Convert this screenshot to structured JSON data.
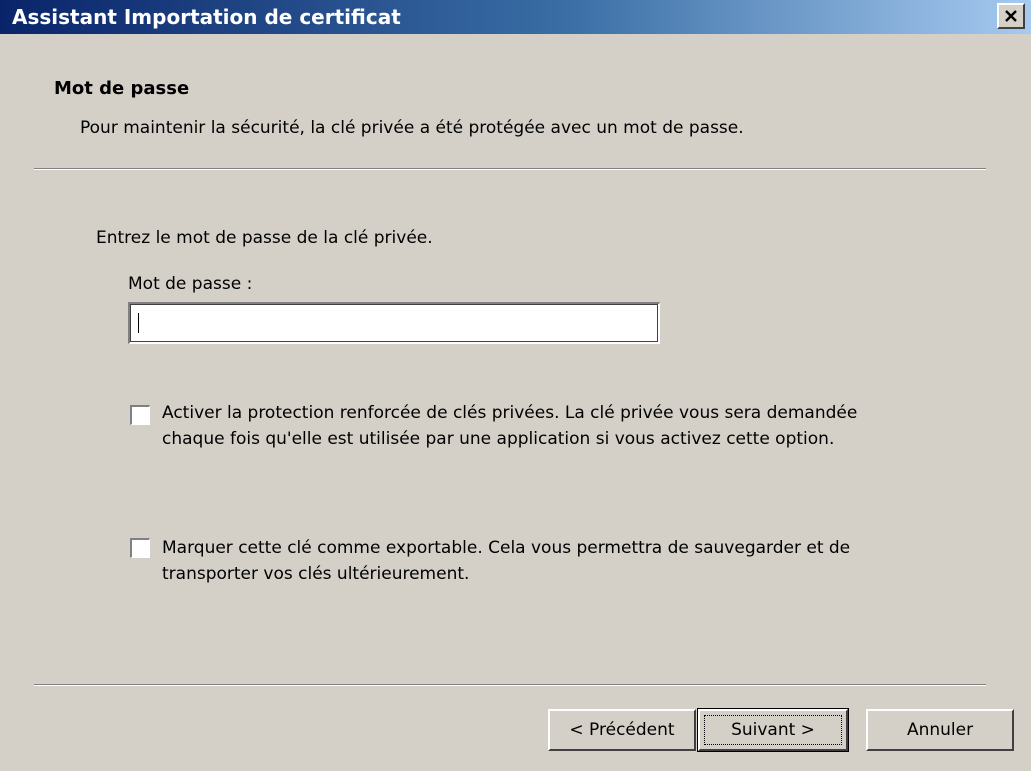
{
  "window": {
    "title": "Assistant Importation de certificat",
    "close_symbol": "✕"
  },
  "header": {
    "title": "Mot de passe",
    "subtitle": "Pour maintenir la sécurité, la clé privée a été protégée avec un mot de passe."
  },
  "form": {
    "intro": "Entrez le mot de passe de la clé privée.",
    "password_label": "Mot de passe :",
    "password_value": "",
    "options": [
      {
        "label": "Activer la protection renforcée de clés privées. La clé privée vous sera demandée chaque fois qu'elle est utilisée par une application si vous activez cette option.",
        "checked": false
      },
      {
        "label": "Marquer cette clé comme exportable. Cela vous permettra de sauvegarder et de transporter vos clés ultérieurement.",
        "checked": false
      }
    ]
  },
  "buttons": {
    "back": "< Précédent",
    "next": "Suivant >",
    "cancel": "Annuler"
  },
  "colors": {
    "titlebar_start": "#0a246a",
    "titlebar_end": "#a6caf0",
    "face": "#d4d0c8"
  }
}
